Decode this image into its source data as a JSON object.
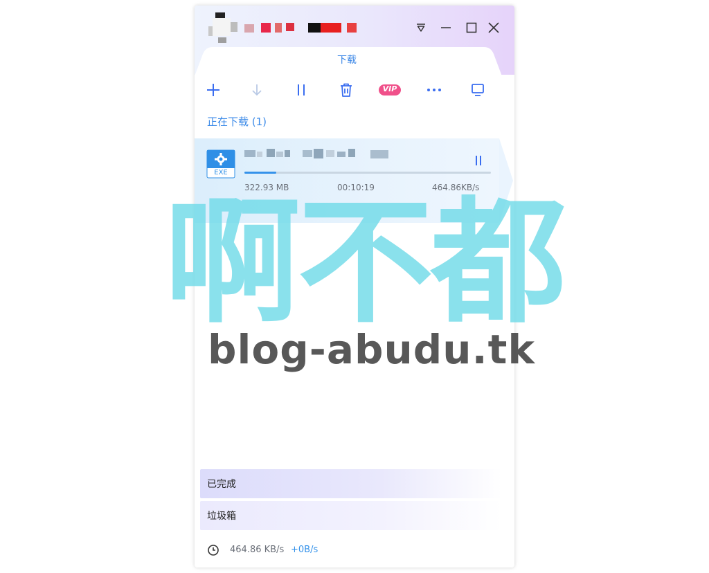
{
  "window": {
    "tab_label": "下载"
  },
  "icons": {
    "titlebar": [
      "dropdown-menu-icon",
      "minimize-icon",
      "maximize-icon",
      "close-icon"
    ],
    "toolbar": [
      "add-icon",
      "download-icon",
      "pause-all-icon",
      "delete-icon",
      "vip-badge",
      "more-icon",
      "monitor-icon"
    ]
  },
  "toolbar": {
    "vip_label": "VIP"
  },
  "downloading": {
    "section_title": "正在下载 (1)",
    "items": [
      {
        "file_type": "EXE",
        "size": "322.93 MB",
        "time_remaining": "00:10:19",
        "speed": "464.86KB/s",
        "progress": 0.13
      }
    ]
  },
  "nav": {
    "completed": "已完成",
    "trash": "垃圾箱"
  },
  "footer": {
    "download_speed": "464.86 KB/s",
    "upload_speed": "+0B/s"
  },
  "watermark": {
    "han_text": "啊不都",
    "url_text": "blog-abudu.tk"
  },
  "colors": {
    "accent": "#3592ea",
    "vip": "#f0508a",
    "watermark_cyan": "#70dae8"
  }
}
